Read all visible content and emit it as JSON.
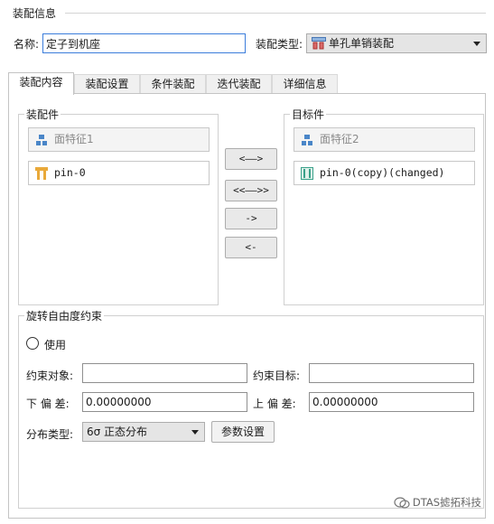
{
  "assembly_info": {
    "section_title": "装配信息",
    "name_label": "名称:",
    "name_value": "定子到机座",
    "type_label": "装配类型:",
    "type_value": "单孔单销装配"
  },
  "tabs": [
    {
      "label": "装配内容",
      "active": true
    },
    {
      "label": "装配设置",
      "active": false
    },
    {
      "label": "条件装配",
      "active": false
    },
    {
      "label": "迭代装配",
      "active": false
    },
    {
      "label": "详细信息",
      "active": false
    }
  ],
  "assembly_parts": {
    "title": "装配件",
    "items": [
      {
        "label": "面特征1",
        "icon": "surface-feature-icon",
        "disabled": true
      },
      {
        "label": "pin-0",
        "icon": "pin-part-icon",
        "disabled": false
      }
    ]
  },
  "target_parts": {
    "title": "目标件",
    "items": [
      {
        "label": "面特征2",
        "icon": "surface-feature-icon",
        "disabled": true
      },
      {
        "label": "pin-0(copy)(changed)",
        "icon": "pin-part-copy-icon",
        "disabled": false
      }
    ]
  },
  "transfer_buttons": [
    "<——>",
    "<<——>>",
    "->",
    "<-"
  ],
  "rotation_constraint": {
    "title": "旋转自由度约束",
    "use_label": "使用",
    "use_checked": false,
    "constraint_object_label": "约束对象:",
    "constraint_object_value": "",
    "constraint_target_label": "约束目标:",
    "constraint_target_value": "",
    "lower_tolerance_label": "下 偏 差:",
    "lower_tolerance_value": "0.00000000",
    "upper_tolerance_label": "上 偏 差:",
    "upper_tolerance_value": "0.00000000",
    "distribution_label": "分布类型:",
    "distribution_value": "6σ 正态分布",
    "param_settings_label": "参数设置"
  },
  "watermark": "DTAS摅拓科技",
  "colors": {
    "accent_border": "#3b7ddb",
    "dropdown_bg": "#e5e5e5"
  }
}
